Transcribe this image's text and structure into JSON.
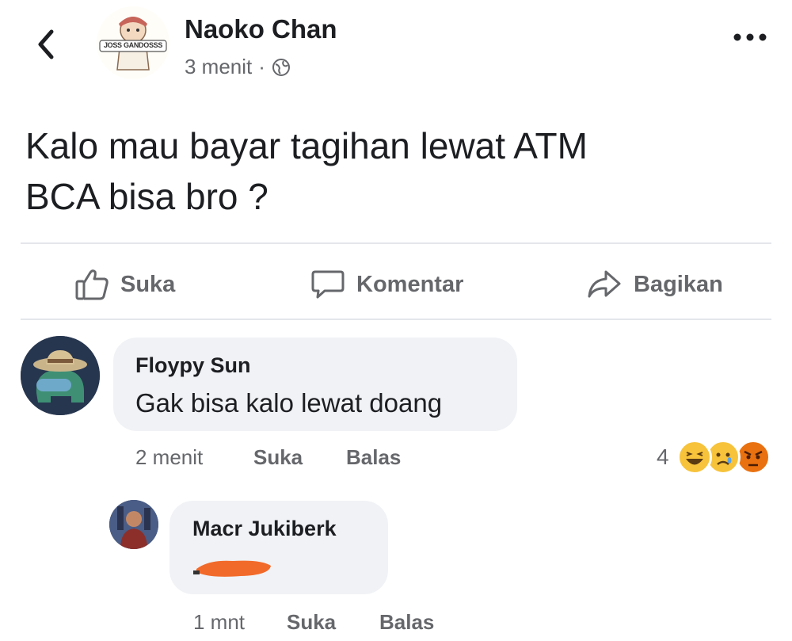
{
  "post": {
    "author": "Naoko Chan",
    "time": "3 menit",
    "separator": "·",
    "avatar_badge": "JOSS GANDOSSS",
    "text_line1": "Kalo mau bayar tagihan lewat ATM",
    "text_line2": "BCA bisa bro ?"
  },
  "actions": {
    "like": "Suka",
    "comment": "Komentar",
    "share": "Bagikan"
  },
  "comments": [
    {
      "author": "Floypy Sun",
      "text": "Gak bisa kalo lewat doang",
      "time": "2 menit",
      "like": "Suka",
      "reply": "Balas",
      "reaction_count": "4",
      "reactions": [
        "haha-icon",
        "sad-icon",
        "angry-icon"
      ]
    },
    {
      "author": "Macr Jukiberk",
      "text": "",
      "time": "1 mnt",
      "like": "Suka",
      "reply": "Balas"
    }
  ],
  "colors": {
    "text_primary": "#1c1e21",
    "text_secondary": "#65676b",
    "bubble": "#f0f2f5",
    "divider": "#e4e6eb",
    "scribble": "#f26a2a",
    "reaction_yellow": "#f7c33b",
    "reaction_red": "#e9710f"
  }
}
